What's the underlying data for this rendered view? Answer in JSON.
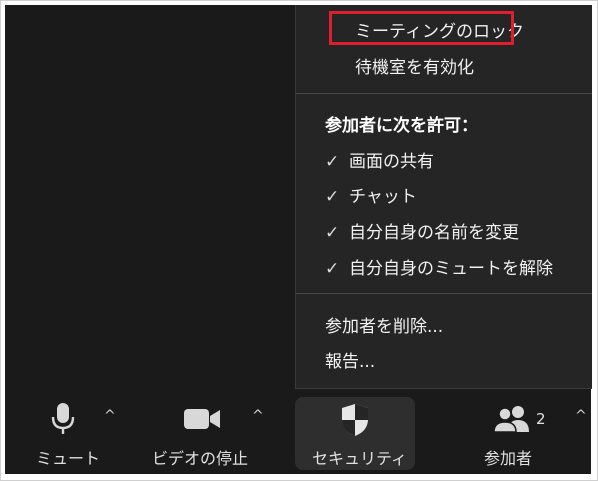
{
  "security_menu": {
    "lock_meeting": "ミーティングのロック",
    "enable_waiting_room": "待機室を有効化",
    "allow_header": "参加者に次を許可：",
    "allow_items": [
      {
        "label": "画面の共有",
        "checked": true
      },
      {
        "label": "チャット",
        "checked": true
      },
      {
        "label": "自分自身の名前を変更",
        "checked": true
      },
      {
        "label": "自分自身のミュートを解除",
        "checked": true
      }
    ],
    "remove_participant": "参加者を削除...",
    "report": "報告...",
    "highlight_color": "#e01e2d"
  },
  "toolbar": {
    "mute_label": "ミュート",
    "video_label": "ビデオの停止",
    "security_label": "セキュリティ",
    "participants_label": "参加者",
    "participants_count": "2",
    "caret": "^"
  },
  "icons": {
    "mic": "microphone-icon",
    "video": "video-camera-icon",
    "security": "shield-icon",
    "participants": "people-icon",
    "check": "checkmark-icon"
  }
}
